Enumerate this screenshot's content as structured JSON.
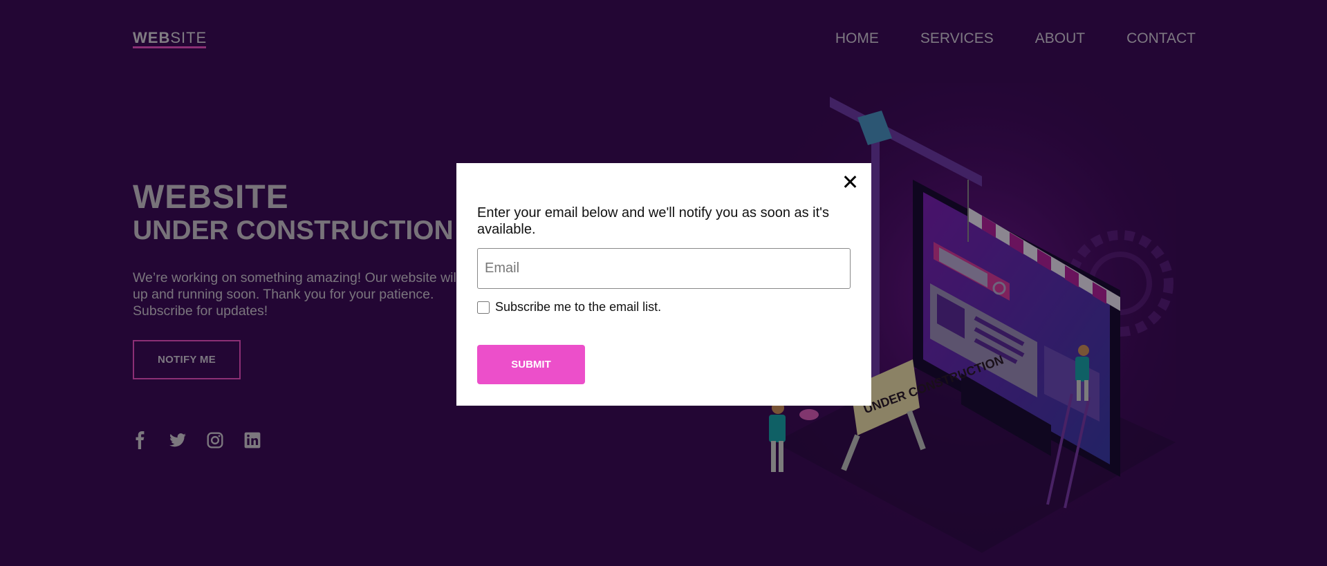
{
  "header": {
    "logo_bold": "WEB",
    "logo_thin": "SITE",
    "nav": [
      "HOME",
      "SERVICES",
      "ABOUT",
      "CONTACT"
    ]
  },
  "hero": {
    "title": "WEBSITE",
    "subtitle": "UNDER CONSTRUCTION",
    "text": "We’re working on something amazing! Our website will be up and running soon. Thank you for your patience. Subscribe for updates!",
    "button": "NOTIFY ME"
  },
  "socials": [
    "facebook-icon",
    "twitter-icon",
    "instagram-icon",
    "linkedin-icon"
  ],
  "modal": {
    "message": "Enter your email below and we'll notify you as soon as it's available.",
    "email_placeholder": "Email",
    "checkbox_label": "Subscribe me to the email list.",
    "submit": "SUBMIT"
  },
  "illustration_sign": "UNDER CONSTRUCTION",
  "colors": {
    "accent": "#e94fc4",
    "background": "#3b0a57"
  }
}
